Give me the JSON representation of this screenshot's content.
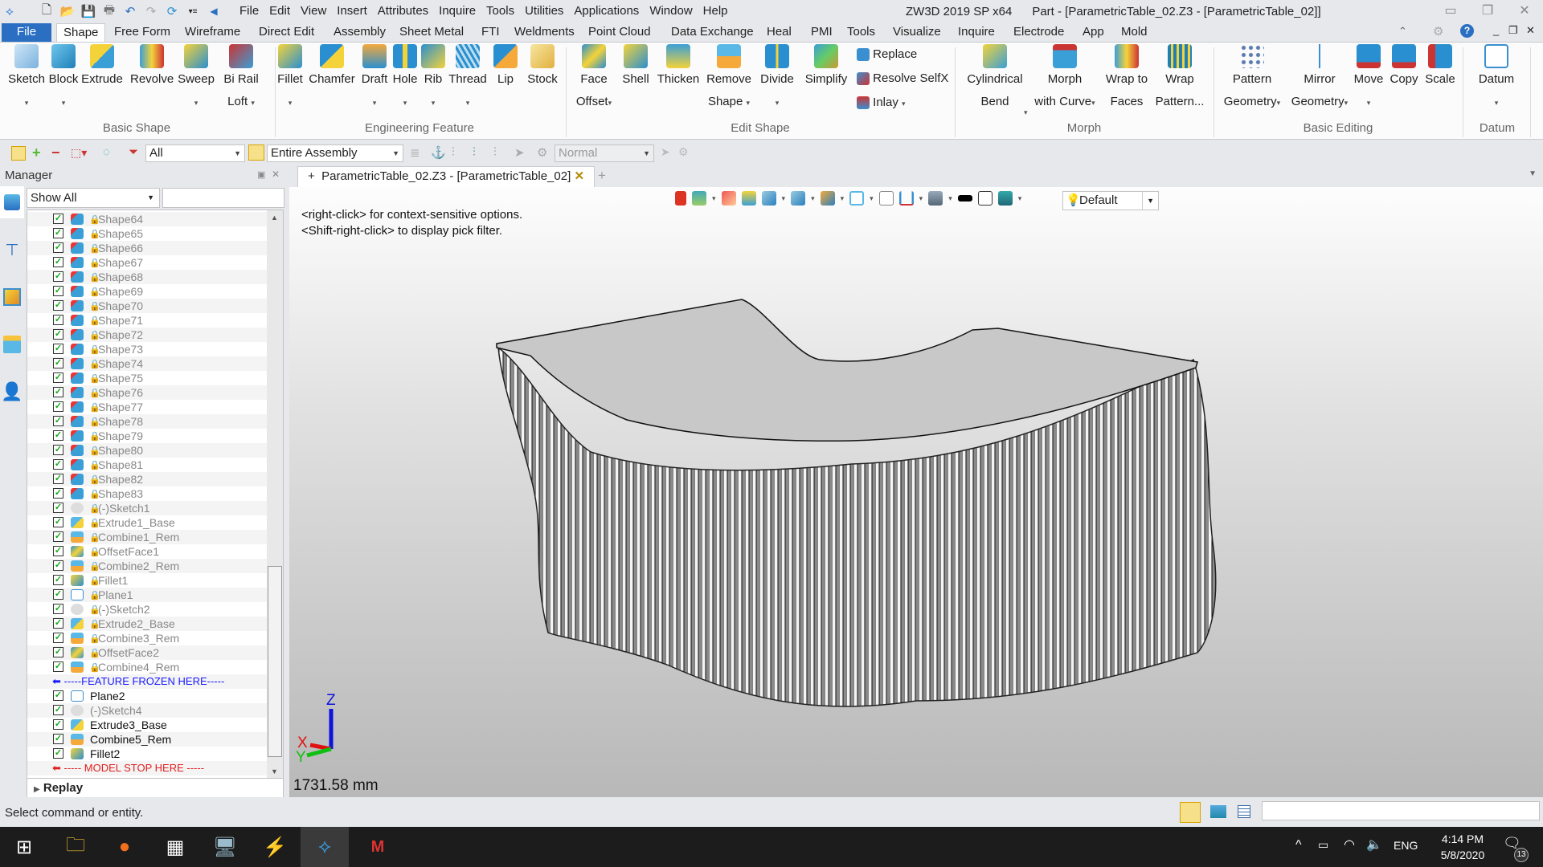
{
  "titlebar": {
    "app_title": "ZW3D 2019 SP x64",
    "doc_title": "Part - [ParametricTable_02.Z3 - [ParametricTable_02]]",
    "menu": [
      "File",
      "Edit",
      "View",
      "Insert",
      "Attributes",
      "Inquire",
      "Tools",
      "Utilities",
      "Applications",
      "Window",
      "Help"
    ]
  },
  "ribbon_tabs": [
    "File",
    "Shape",
    "Free Form",
    "Wireframe",
    "Direct Edit",
    "Assembly",
    "Sheet Metal",
    "FTI",
    "Weldments",
    "Point Cloud",
    "Data Exchange",
    "Heal",
    "PMI",
    "Tools",
    "Visualize",
    "Inquire",
    "Electrode",
    "App",
    "Mold"
  ],
  "ribbon_active_tab": "Shape",
  "ribbon": {
    "groups": [
      "Basic Shape",
      "Engineering Feature",
      "Edit Shape",
      "Morph",
      "Basic Editing",
      "Datum"
    ],
    "buttons": [
      {
        "l1": "Sketch",
        "l2": ""
      },
      {
        "l1": "Block",
        "l2": ""
      },
      {
        "l1": "Extrude",
        "l2": ""
      },
      {
        "l1": "Revolve",
        "l2": ""
      },
      {
        "l1": "Sweep",
        "l2": ""
      },
      {
        "l1": "Bi Rail",
        "l2": "Loft"
      },
      {
        "l1": "Fillet",
        "l2": ""
      },
      {
        "l1": "Chamfer",
        "l2": ""
      },
      {
        "l1": "Draft",
        "l2": ""
      },
      {
        "l1": "Hole",
        "l2": ""
      },
      {
        "l1": "Rib",
        "l2": ""
      },
      {
        "l1": "Thread",
        "l2": ""
      },
      {
        "l1": "Lip",
        "l2": ""
      },
      {
        "l1": "Stock",
        "l2": ""
      },
      {
        "l1": "Face",
        "l2": "Offset"
      },
      {
        "l1": "Shell",
        "l2": ""
      },
      {
        "l1": "Thicken",
        "l2": ""
      },
      {
        "l1": "Remove",
        "l2": "Shape"
      },
      {
        "l1": "Divide",
        "l2": ""
      },
      {
        "l1": "Simplify",
        "l2": ""
      },
      {
        "l1": "Cylindrical",
        "l2": "Bend"
      },
      {
        "l1": "Morph",
        "l2": "with Curve"
      },
      {
        "l1": "Wrap to",
        "l2": "Faces"
      },
      {
        "l1": "Wrap",
        "l2": "Pattern..."
      },
      {
        "l1": "Pattern",
        "l2": "Geometry"
      },
      {
        "l1": "Mirror",
        "l2": "Geometry"
      },
      {
        "l1": "Move",
        "l2": ""
      },
      {
        "l1": "Copy",
        "l2": ""
      },
      {
        "l1": "Scale",
        "l2": ""
      },
      {
        "l1": "Datum",
        "l2": ""
      }
    ],
    "small_buttons": [
      "Replace",
      "Resolve SelfX",
      "Inlay"
    ]
  },
  "toolbar2": {
    "filter": "All",
    "scope": "Entire Assembly",
    "mode": "Normal"
  },
  "manager": {
    "title": "Manager",
    "show": "Show All",
    "replay": "Replay",
    "rows": [
      {
        "t": "Shape64",
        "k": "shape",
        "lock": true
      },
      {
        "t": "Shape65",
        "k": "shape",
        "lock": true
      },
      {
        "t": "Shape66",
        "k": "shape",
        "lock": true
      },
      {
        "t": "Shape67",
        "k": "shape",
        "lock": true
      },
      {
        "t": "Shape68",
        "k": "shape",
        "lock": true
      },
      {
        "t": "Shape69",
        "k": "shape",
        "lock": true
      },
      {
        "t": "Shape70",
        "k": "shape",
        "lock": true
      },
      {
        "t": "Shape71",
        "k": "shape",
        "lock": true
      },
      {
        "t": "Shape72",
        "k": "shape",
        "lock": true
      },
      {
        "t": "Shape73",
        "k": "shape",
        "lock": true
      },
      {
        "t": "Shape74",
        "k": "shape",
        "lock": true
      },
      {
        "t": "Shape75",
        "k": "shape",
        "lock": true
      },
      {
        "t": "Shape76",
        "k": "shape",
        "lock": true
      },
      {
        "t": "Shape77",
        "k": "shape",
        "lock": true
      },
      {
        "t": "Shape78",
        "k": "shape",
        "lock": true
      },
      {
        "t": "Shape79",
        "k": "shape",
        "lock": true
      },
      {
        "t": "Shape80",
        "k": "shape",
        "lock": true
      },
      {
        "t": "Shape81",
        "k": "shape",
        "lock": true
      },
      {
        "t": "Shape82",
        "k": "shape",
        "lock": true
      },
      {
        "t": "Shape83",
        "k": "shape",
        "lock": true
      },
      {
        "t": "(-)Sketch1",
        "k": "sketch",
        "lock": true
      },
      {
        "t": "Extrude1_Base",
        "k": "extrude",
        "lock": true
      },
      {
        "t": "Combine1_Rem",
        "k": "combine",
        "lock": true
      },
      {
        "t": "OffsetFace1",
        "k": "offset",
        "lock": true
      },
      {
        "t": "Combine2_Rem",
        "k": "combine",
        "lock": true
      },
      {
        "t": "Fillet1",
        "k": "fillet",
        "lock": true
      },
      {
        "t": "Plane1",
        "k": "plane",
        "lock": true
      },
      {
        "t": "(-)Sketch2",
        "k": "sketch",
        "lock": true
      },
      {
        "t": "Extrude2_Base",
        "k": "extrude",
        "lock": true
      },
      {
        "t": "Combine3_Rem",
        "k": "combine",
        "lock": true
      },
      {
        "t": "OffsetFace2",
        "k": "offset",
        "lock": true
      },
      {
        "t": "Combine4_Rem",
        "k": "combine",
        "lock": true
      },
      {
        "t": "-----FEATURE FROZEN HERE-----",
        "k": "frozen",
        "lock": false
      },
      {
        "t": "Plane2",
        "k": "plane",
        "lock": false
      },
      {
        "t": "(-)Sketch4",
        "k": "sketch",
        "lock": false
      },
      {
        "t": "Extrude3_Base",
        "k": "extrude",
        "lock": false
      },
      {
        "t": "Combine5_Rem",
        "k": "combine",
        "lock": false
      },
      {
        "t": "Fillet2",
        "k": "fillet",
        "lock": false
      },
      {
        "t": "----- MODEL STOP HERE -----",
        "k": "stop",
        "lock": false
      }
    ]
  },
  "viewport": {
    "tab": "ParametricTable_02.Z3 - [ParametricTable_02]",
    "hint1": "<right-click> for context-sensitive options.",
    "hint2": "<Shift-right-click> to display pick filter.",
    "render_style": "Default",
    "scale": "1731.58 mm",
    "axes": {
      "x": "X",
      "y": "Y",
      "z": "Z"
    }
  },
  "status": {
    "text": "Select command or entity."
  },
  "taskbar": {
    "time": "4:14 PM",
    "date": "5/8/2020",
    "lang": "ENG",
    "notifications": "13"
  },
  "colors": {
    "file_tab": "#2a6fc2",
    "frozen": "#1a1aff",
    "stop": "#e02020"
  }
}
